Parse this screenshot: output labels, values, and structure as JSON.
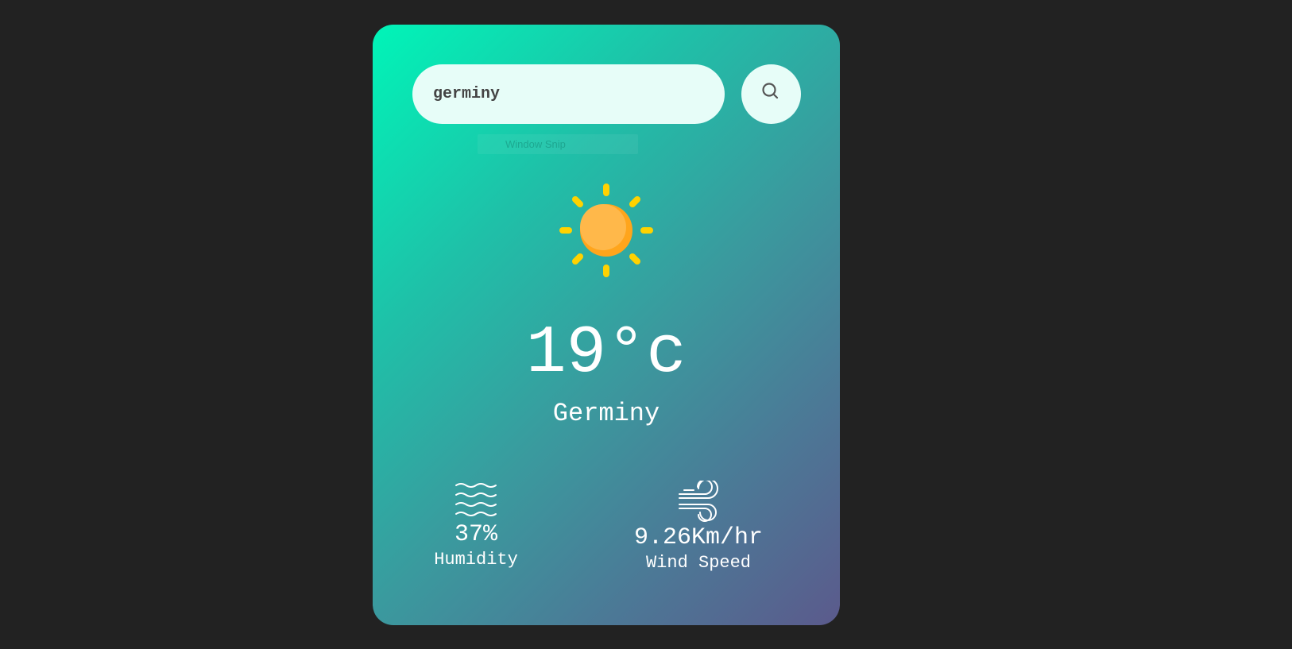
{
  "search": {
    "value": "germiny",
    "button_icon": "search-icon"
  },
  "tooltip": {
    "text": "Window Snip"
  },
  "weather": {
    "icon": "sun-icon",
    "temperature": "19°c",
    "city": "Germiny"
  },
  "details": {
    "humidity": {
      "icon": "humidity-icon",
      "value": "37%",
      "label": "Humidity"
    },
    "wind": {
      "icon": "wind-icon",
      "value": "9.26Km/hr",
      "label": "Wind Speed"
    }
  },
  "colors": {
    "background": "#222222",
    "gradient_start": "#00f5b8",
    "gradient_end": "#5b5a8c",
    "input_bg": "#e7fdf8",
    "sun_core": "#ffb340",
    "sun_rays": "#ffd200"
  }
}
